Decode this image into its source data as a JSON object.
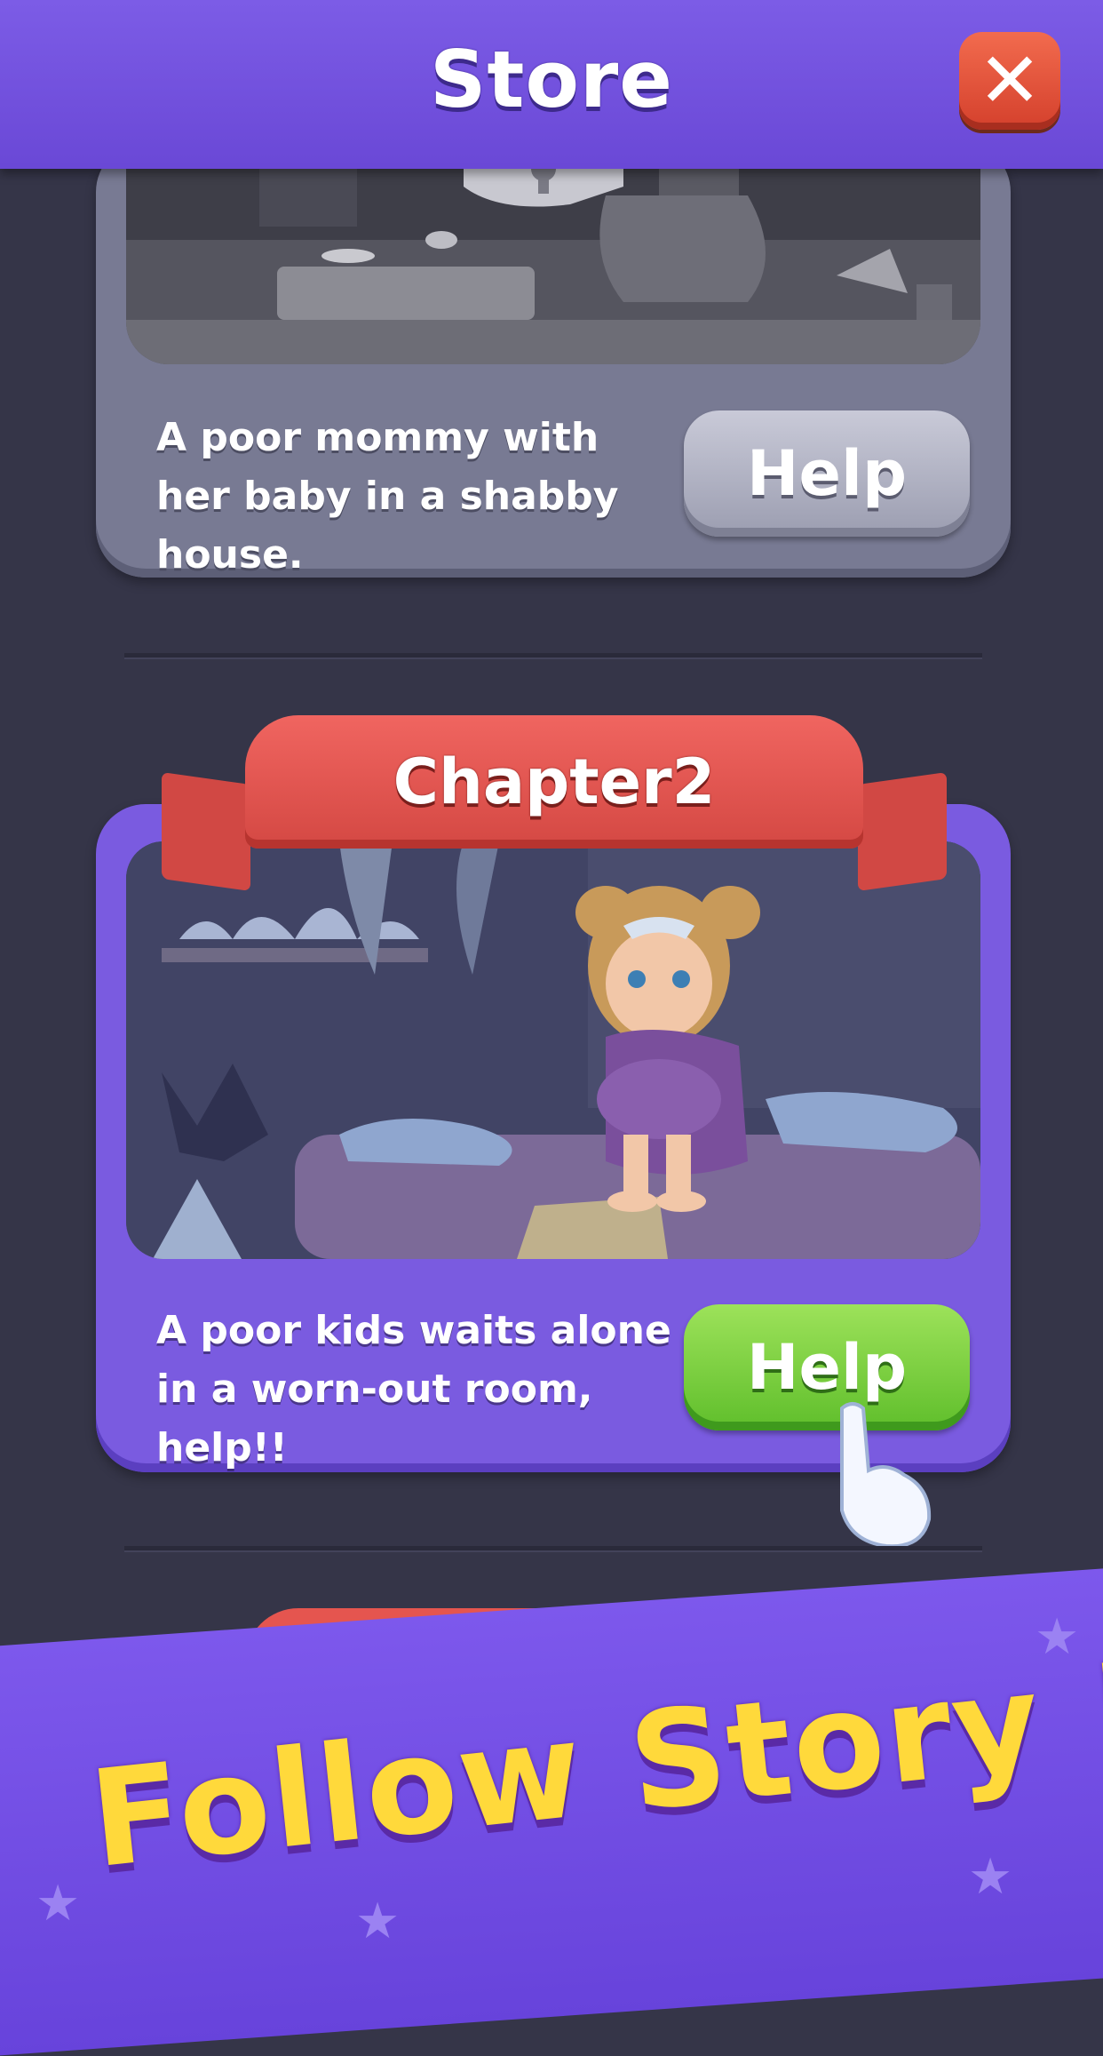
{
  "header": {
    "title": "Store",
    "close_label": "✕"
  },
  "chapters": [
    {
      "title": "",
      "description": "A poor mommy with her baby in a shabby house.",
      "button": "Help",
      "state": "locked"
    },
    {
      "title": "Chapter2",
      "description": "A poor kids waits alone in a worn-out room, help!!",
      "button": "Help",
      "state": "active"
    }
  ],
  "promo": {
    "text": "Follow Story !"
  },
  "colors": {
    "accent": "#7a5be0",
    "help_active": "#6cc737",
    "ribbon": "#e5554f",
    "promo_text": "#ffd93b"
  }
}
